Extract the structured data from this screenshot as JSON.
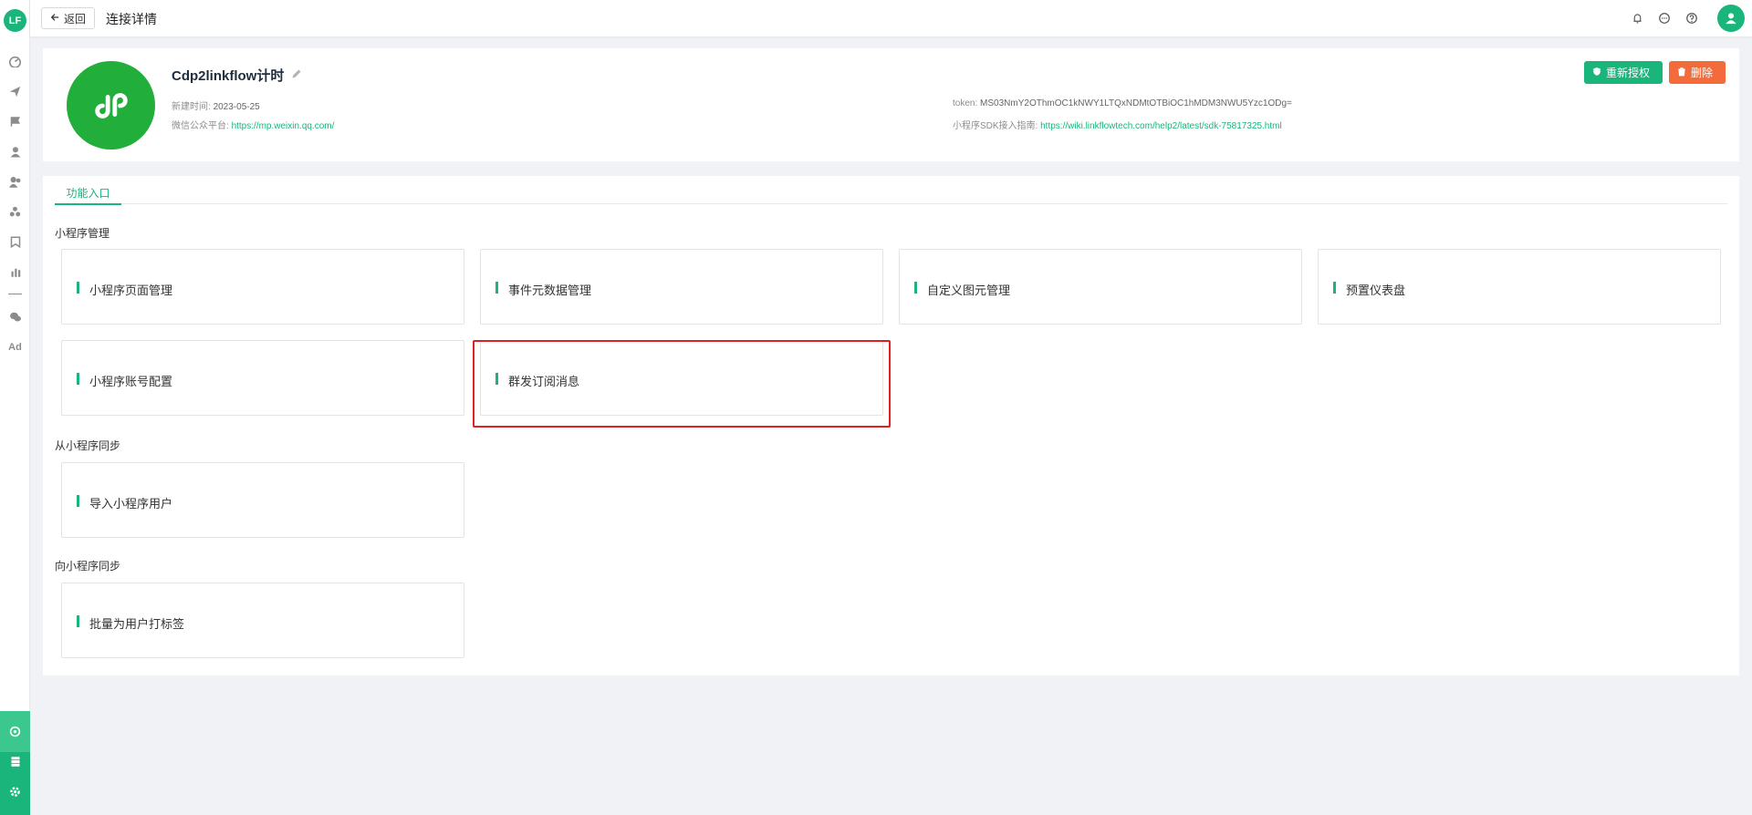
{
  "sidebar": {
    "logo_text": "LF",
    "items": [
      {
        "icon": "dashboard-icon"
      },
      {
        "icon": "send-icon"
      },
      {
        "icon": "flag-icon"
      },
      {
        "icon": "user-icon"
      },
      {
        "icon": "users-icon"
      },
      {
        "icon": "cluster-icon"
      },
      {
        "icon": "bookmark-icon"
      },
      {
        "icon": "bar-chart-icon"
      },
      {
        "icon": "wechat-icon"
      },
      {
        "icon": "ad-icon",
        "label": "Ad"
      }
    ],
    "bottom_items": [
      {
        "icon": "connector-icon"
      },
      {
        "icon": "database-icon"
      },
      {
        "icon": "settings-icon"
      }
    ]
  },
  "topbar": {
    "back_label": "返回",
    "title": "连接详情"
  },
  "connection": {
    "name": "Cdp2linkflow计时",
    "created_label": "新建时间:",
    "created_value": "2023-05-25",
    "platform_label": "微信公众平台:",
    "platform_url": "https://mp.weixin.qq.com/",
    "token_label": "token:",
    "token_value": "MS03NmY2OThmOC1kNWY1LTQxNDMtOTBiOC1hMDM3NWU5Yzc1ODg=",
    "sdk_label": "小程序SDK接入指南:",
    "sdk_url": "https://wiki.linkflowtech.com/help2/latest/sdk-75817325.html",
    "reauth_label": "重新授权",
    "delete_label": "删除"
  },
  "tabs": [
    {
      "label": "功能入口",
      "active": true
    }
  ],
  "sections": {
    "s1_title": "小程序管理",
    "s2_title": "从小程序同步",
    "s3_title": "向小程序同步"
  },
  "entries": {
    "e1": "小程序页面管理",
    "e2": "事件元数据管理",
    "e3": "自定义图元管理",
    "e4": "预置仪表盘",
    "e5": "小程序账号配置",
    "e6": "群发订阅消息",
    "e7": "导入小程序用户",
    "e8": "批量为用户打标签"
  },
  "colors": {
    "brand": "#19b57a",
    "danger": "#f46b3b",
    "highlight": "#e02020",
    "miniprogram": "#22ae3a"
  }
}
